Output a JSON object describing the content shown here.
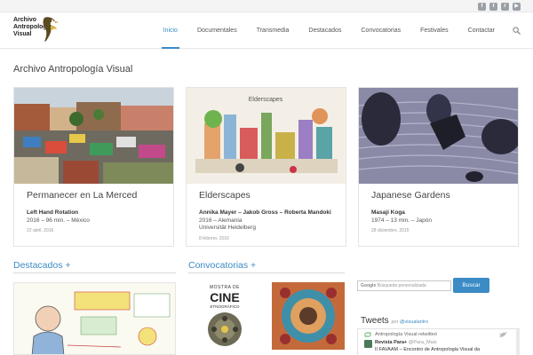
{
  "logo": {
    "line1": "Archivo",
    "line2": "Antropología",
    "line3": "Visual"
  },
  "social_icons": [
    "facebook-icon",
    "twitter-icon",
    "rss-icon",
    "youtube-icon"
  ],
  "nav": {
    "items": [
      "Inicio",
      "Documentales",
      "Transmedia",
      "Destacados",
      "Convocatorias",
      "Festivales",
      "Contactar"
    ],
    "active": "Inicio"
  },
  "page_title": "Archivo Antropología Visual",
  "cards": [
    {
      "title": "Permanecer en La Merced",
      "author": "Left Hand Rotation",
      "info": "2016 – 96 min. – México",
      "extra": "",
      "date": "22 abril, 2016"
    },
    {
      "title": "Elderscapes",
      "image_label": "Elderscapes",
      "author": "Annika Mayer – Jakob Gross – Roberta Mandoki",
      "info": "2016 – Alemania",
      "extra": "Universität Heidelberg",
      "date": "8 febrero, 2016"
    },
    {
      "title": "Japanese Gardens",
      "author": "Masaji Koga",
      "info": "1974 – 13 min. – Japón",
      "extra": "",
      "date": "28 diciembre, 2015"
    }
  ],
  "sections": {
    "destacados": "Destacados +",
    "convocatorias": "Convocatorias +"
  },
  "poster": {
    "line1": "MOSTRA DE",
    "line2": "CINE",
    "line3": "ETNOGRÁFICO"
  },
  "sidebar": {
    "search_placeholder": "Búsqueda personalizada",
    "google_label": "Google",
    "search_button": "Buscar",
    "tweets_title": "Tweets",
    "tweets_by": "por",
    "tweets_handle": "@visualantro",
    "retweet_text": "Antropología Visual retwitteó",
    "tweet_author": "Revista Para+",
    "tweet_handle": "@Para_Mais",
    "tweet_text": "II FAVAAM – Encontro de Antropologia Visual da"
  },
  "colors": {
    "accent": "#3b8bc5",
    "text": "#444444"
  }
}
